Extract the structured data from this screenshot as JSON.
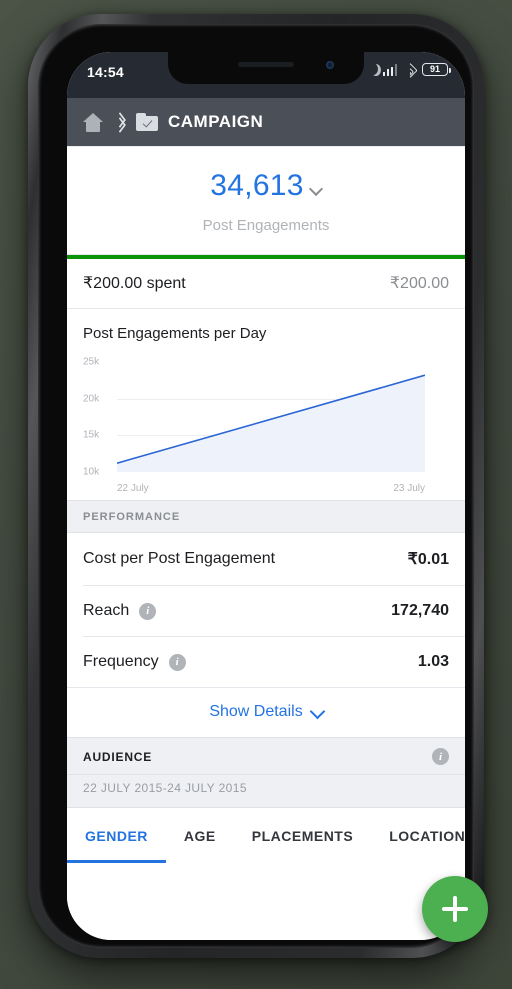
{
  "status_bar": {
    "time": "14:54",
    "battery_level": "91",
    "icons": [
      "moon-icon",
      "signal-icon",
      "wifi-icon",
      "battery-icon"
    ]
  },
  "header": {
    "home_icon": "home-icon",
    "chevron_icon": "breadcrumb-chevron-icon",
    "folder_icon": "folder-check-icon",
    "title": "CAMPAIGN"
  },
  "summary": {
    "value": "34,613",
    "label": "Post Engagements",
    "chevron_icon": "chevron-down-icon"
  },
  "spend": {
    "progress_percent": 100,
    "progress_color": "#0a9409",
    "spent_label": "₹200.00 spent",
    "budget_value": "₹200.00"
  },
  "chart_data": {
    "type": "area",
    "title": "Post Engagements per Day",
    "xlabel": "",
    "ylabel": "",
    "x": [
      "22 July",
      "23 July"
    ],
    "tick_labels_x": [
      "22 July",
      "23 July"
    ],
    "tick_labels_y": [
      "25k",
      "20k",
      "15k",
      "10k"
    ],
    "yticks": [
      25000,
      20000,
      15000,
      10000
    ],
    "ylim": [
      10000,
      25000
    ],
    "grid": true,
    "gridlines_at": [
      20000,
      15000
    ],
    "legend": "none",
    "series": [
      {
        "name": "Post Engagements per Day",
        "values": [
          11200,
          23200
        ],
        "line_color": "#2a65d6",
        "fill_color": "#eef2fb"
      }
    ]
  },
  "performance": {
    "section_title": "PERFORMANCE",
    "rows": [
      {
        "label": "Cost per Post Engagement",
        "value": "₹0.01",
        "info_icon": false
      },
      {
        "label": "Reach",
        "value": "172,740",
        "info_icon": true
      },
      {
        "label": "Frequency",
        "value": "1.03",
        "info_icon": true
      }
    ],
    "show_details_label": "Show Details",
    "show_details_chevron_icon": "chevron-down-icon"
  },
  "audience": {
    "section_title": "AUDIENCE",
    "info_icon": "info-icon",
    "date_range": "22 JULY 2015-24 JULY 2015",
    "tabs": [
      {
        "label": "GENDER",
        "active": true
      },
      {
        "label": "AGE",
        "active": false
      },
      {
        "label": "PLACEMENTS",
        "active": false
      },
      {
        "label": "LOCATION",
        "active": false
      }
    ]
  },
  "fab": {
    "icon": "plus-icon",
    "color": "#4caf50"
  },
  "theme": {
    "accent_blue": "#2374e1",
    "header_bg": "#4b4f58",
    "status_bg": "#262a33",
    "green": "#0a9409"
  }
}
